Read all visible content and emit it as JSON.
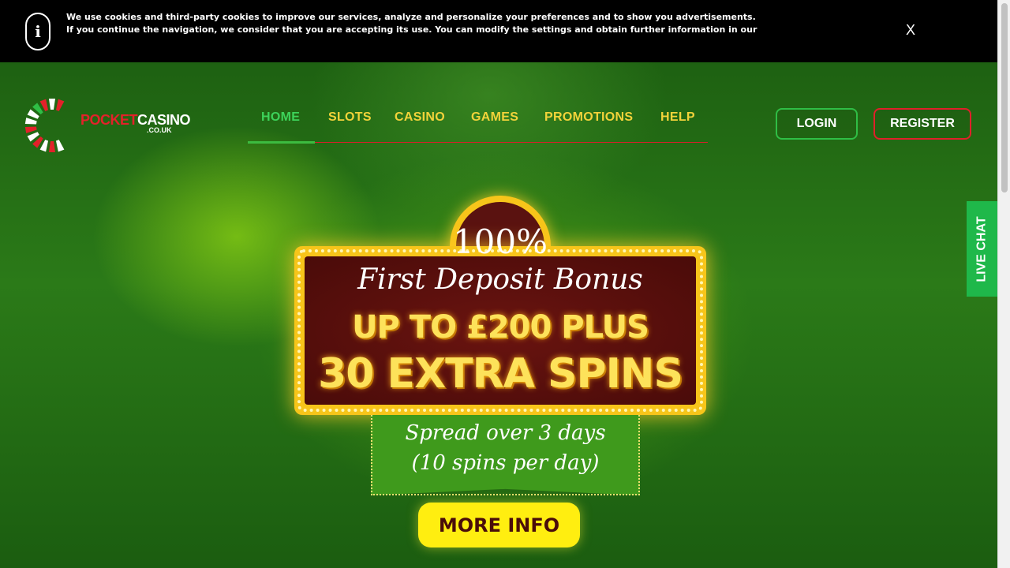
{
  "cookie_bar": {
    "info_icon": "i",
    "text": "We use cookies and third-party cookies to improve our services, analyze and personalize your preferences and to show you advertisements. If you continue the navigation, we consider that you are accepting its use. You can modify the settings and obtain further information in our",
    "close_label": "X"
  },
  "logo": {
    "part1": "POCKET",
    "part2": "CASINO",
    "sub": ".CO.UK",
    "colors": {
      "red": "#e3212a",
      "white": "#ffffff",
      "green": "#2fbe45"
    }
  },
  "nav": {
    "items": [
      {
        "label": "HOME",
        "active": true
      },
      {
        "label": "SLOTS"
      },
      {
        "label": "CASINO"
      },
      {
        "label": "GAMES"
      },
      {
        "label": "PROMOTIONS"
      },
      {
        "label": "HELP"
      }
    ]
  },
  "auth": {
    "login_label": "LOGIN",
    "register_label": "REGISTER"
  },
  "live_chat": {
    "label": "LIVE CHAT"
  },
  "banner": {
    "percent": "100%",
    "headline": "First Deposit Bonus",
    "line1": "UP TO £200 PLUS",
    "line2": "30 EXTRA SPINS",
    "ribbon_line1": "Spread over 3 days",
    "ribbon_line2": "(10 spins per day)",
    "cta_label": "MORE INFO"
  },
  "theme": {
    "accent_gold": "#f7c51a",
    "nav_text": "#f2d33a",
    "nav_active": "#3dd35a",
    "cta_yellow": "#ffee10",
    "live_chat_green": "#1fb84a"
  }
}
